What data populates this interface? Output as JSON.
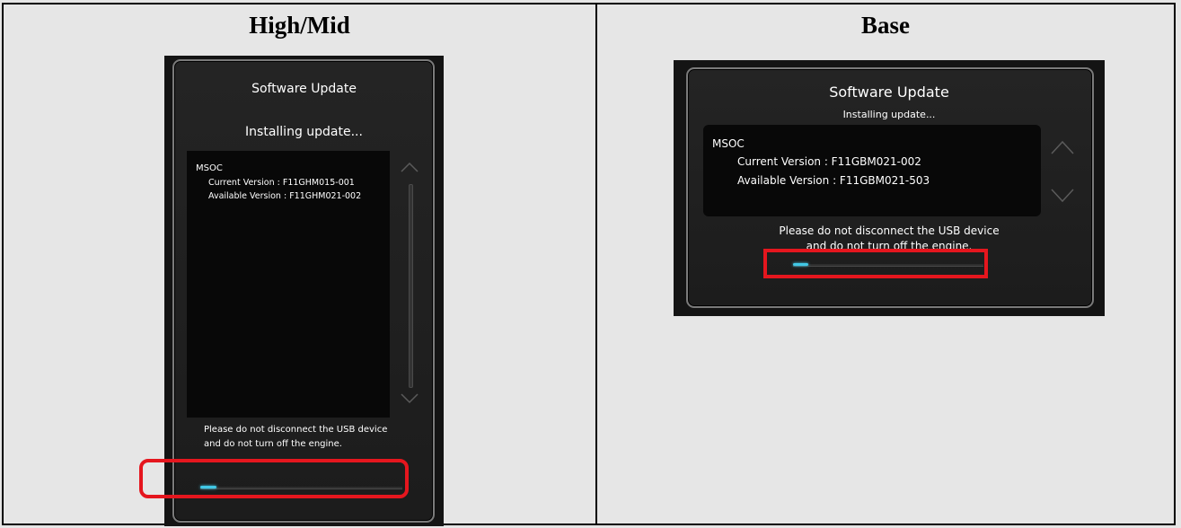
{
  "columns": [
    {
      "heading": "High/Mid",
      "screen": {
        "title": "Software Update",
        "status": "Installing update...",
        "module": "MSOC",
        "current_version": "Current Version   : F11GHM015-001",
        "available_version": "Available Version : F11GHM021-002",
        "warning_line1": "Please do not disconnect the USB device",
        "warning_line2": "and do not turn off the engine.",
        "progress": 0.08
      }
    },
    {
      "heading": "Base",
      "screen": {
        "title": "Software Update",
        "status": "Installing update...",
        "module": "MSOC",
        "current_version": "Current Version   : F11GBM021-002",
        "available_version": "Available Version  : F11GBM021-503",
        "warning_line1": "Please do not disconnect the USB device",
        "warning_line2": "and do not turn off the engine.",
        "progress": 0.08
      }
    }
  ],
  "colors": {
    "highlight": "#e5161e",
    "progress_fill": "#41c8e6",
    "screen_bg": "#141414",
    "cell_bg": "#e6e6e6"
  },
  "icons": [
    "chevron-up-icon",
    "chevron-down-icon"
  ]
}
